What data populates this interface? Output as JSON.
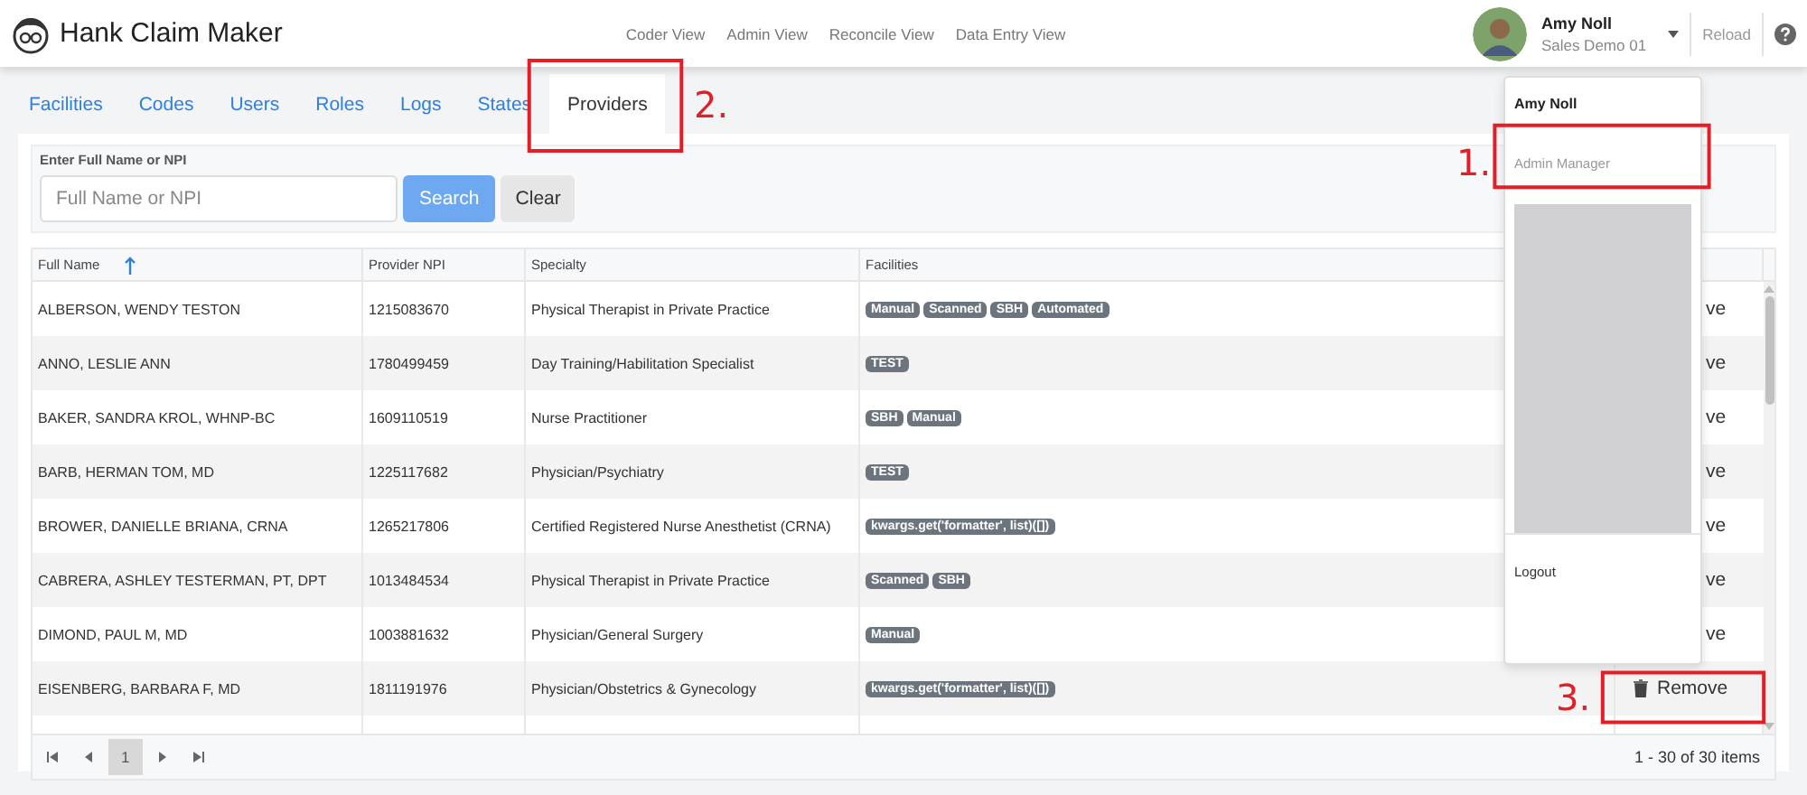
{
  "app": {
    "title": "Hank Claim Maker"
  },
  "nav": [
    "Coder View",
    "Admin View",
    "Reconcile View",
    "Data Entry View"
  ],
  "user": {
    "name": "Amy Noll",
    "subtitle": "Sales Demo 01"
  },
  "reload": "Reload",
  "tabs": [
    {
      "label": "Facilities",
      "selected": false
    },
    {
      "label": "Codes",
      "selected": false
    },
    {
      "label": "Users",
      "selected": false
    },
    {
      "label": "Roles",
      "selected": false
    },
    {
      "label": "Logs",
      "selected": false
    },
    {
      "label": "States",
      "selected": false
    },
    {
      "label": "Providers",
      "selected": true
    }
  ],
  "search": {
    "label": "Enter Full Name or NPI",
    "placeholder": "Full Name or NPI",
    "search_button": "Search",
    "clear_button": "Clear"
  },
  "table": {
    "columns": [
      "Full Name",
      "Provider NPI",
      "Specialty",
      "Facilities"
    ],
    "rows": [
      {
        "name": "ALBERSON, WENDY TESTON",
        "npi": "1215083670",
        "specialty": "Physical Therapist in Private Practice",
        "facilities": [
          "Manual",
          "Scanned",
          "SBH",
          "Automated"
        ],
        "action": "ve",
        "action_full": false
      },
      {
        "name": "ANNO, LESLIE ANN",
        "npi": "1780499459",
        "specialty": "Day Training/Habilitation Specialist",
        "facilities": [
          "TEST"
        ],
        "action": "ve",
        "action_full": false
      },
      {
        "name": "BAKER, SANDRA KROL, WHNP-BC",
        "npi": "1609110519",
        "specialty": "Nurse Practitioner",
        "facilities": [
          "SBH",
          "Manual"
        ],
        "action": "ve",
        "action_full": false
      },
      {
        "name": "BARB, HERMAN TOM, MD",
        "npi": "1225117682",
        "specialty": "Physician/Psychiatry",
        "facilities": [
          "TEST"
        ],
        "action": "ve",
        "action_full": false
      },
      {
        "name": "BROWER, DANIELLE BRIANA, CRNA",
        "npi": "1265217806",
        "specialty": "Certified Registered Nurse Anesthetist (CRNA)",
        "facilities": [
          "kwargs.get('formatter', list)([])"
        ],
        "action": "ve",
        "action_full": false
      },
      {
        "name": "CABRERA, ASHLEY TESTERMAN, PT, DPT",
        "npi": "1013484534",
        "specialty": "Physical Therapist in Private Practice",
        "facilities": [
          "Scanned",
          "SBH"
        ],
        "action": "ve",
        "action_full": false
      },
      {
        "name": "DIMOND, PAUL M, MD",
        "npi": "1003881632",
        "specialty": "Physician/General Surgery",
        "facilities": [
          "Manual"
        ],
        "action": "ve",
        "action_full": false
      },
      {
        "name": "EISENBERG, BARBARA F, MD",
        "npi": "1811191976",
        "specialty": "Physician/Obstetrics & Gynecology",
        "facilities": [
          "kwargs.get('formatter', list)([])"
        ],
        "action": "Remove",
        "action_full": true
      }
    ]
  },
  "pager": {
    "pages": [
      {
        "label": "1",
        "selected": true
      }
    ],
    "summary": "1 - 30 of 30 items"
  },
  "menu": {
    "name": "Amy Noll",
    "items": [
      "Admin Manager"
    ],
    "logout": "Logout"
  },
  "annotations": [
    {
      "label": "2."
    },
    {
      "label": "1."
    },
    {
      "label": "3."
    }
  ]
}
